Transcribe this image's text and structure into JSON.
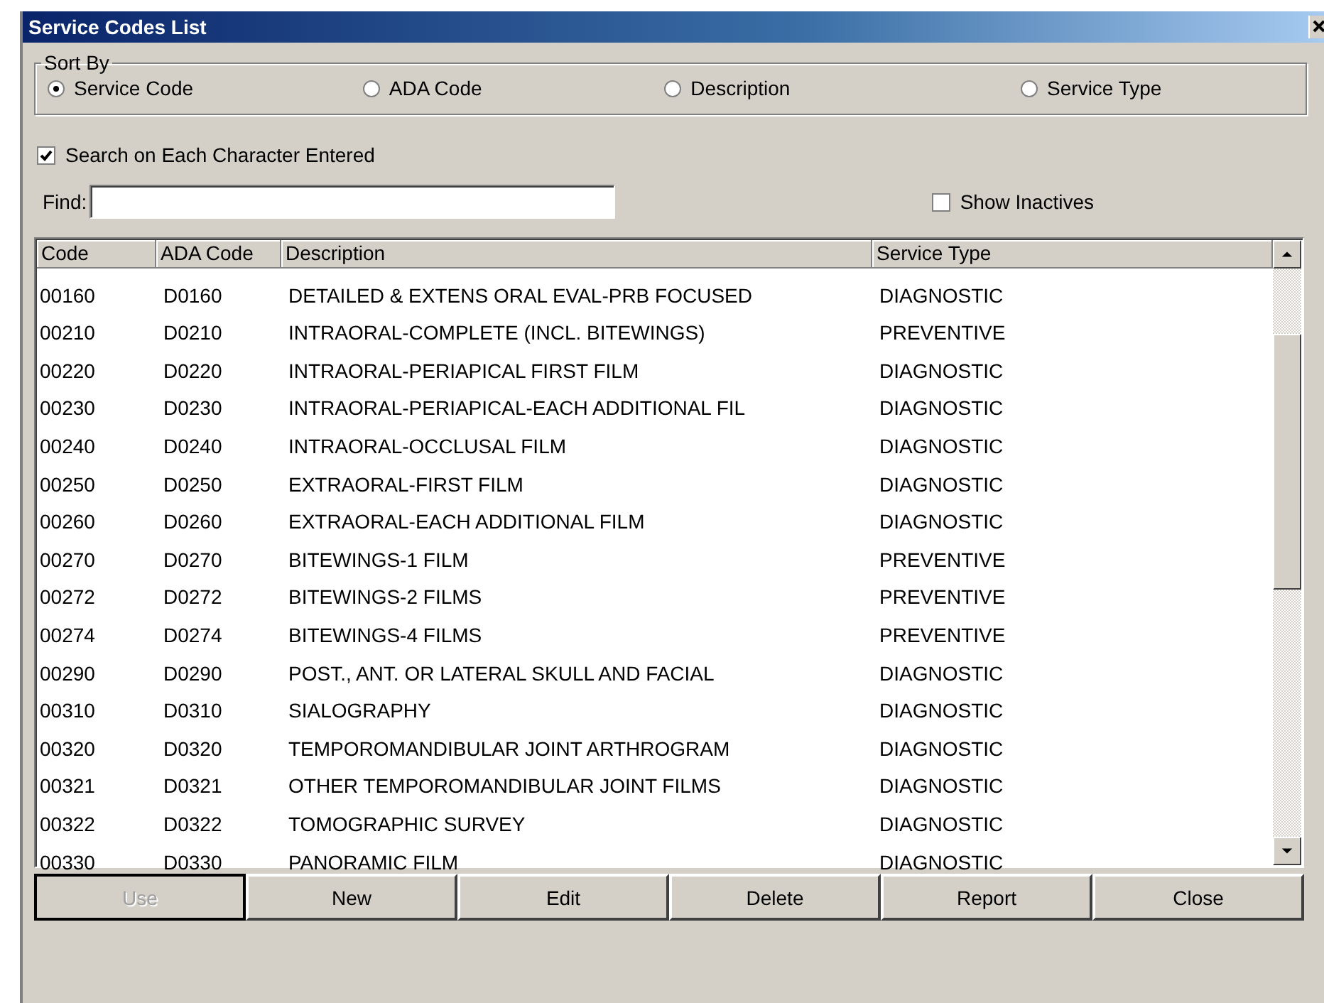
{
  "window": {
    "title": "Service Codes List"
  },
  "sort_by": {
    "label": "Sort By",
    "options": [
      {
        "label": "Service Code",
        "selected": true
      },
      {
        "label": "ADA Code",
        "selected": false
      },
      {
        "label": "Description",
        "selected": false
      },
      {
        "label": "Service Type",
        "selected": false
      }
    ]
  },
  "search_each_char": {
    "label": "Search on Each Character Entered",
    "checked": true
  },
  "find": {
    "label": "Find:"
  },
  "show_inactives": {
    "label": "Show Inactives",
    "checked": false
  },
  "table": {
    "columns": [
      "Code",
      "ADA Code",
      "Description",
      "Service Type"
    ],
    "rows": [
      [
        "00160",
        "D0160",
        "DETAILED & EXTENS ORAL EVAL-PRB FOCUSED",
        "DIAGNOSTIC"
      ],
      [
        "00210",
        "D0210",
        "INTRAORAL-COMPLETE (INCL. BITEWINGS)",
        "PREVENTIVE"
      ],
      [
        "00220",
        "D0220",
        "INTRAORAL-PERIAPICAL FIRST FILM",
        "DIAGNOSTIC"
      ],
      [
        "00230",
        "D0230",
        "INTRAORAL-PERIAPICAL-EACH ADDITIONAL FIL",
        "DIAGNOSTIC"
      ],
      [
        "00240",
        "D0240",
        "INTRAORAL-OCCLUSAL FILM",
        "DIAGNOSTIC"
      ],
      [
        "00250",
        "D0250",
        "EXTRAORAL-FIRST FILM",
        "DIAGNOSTIC"
      ],
      [
        "00260",
        "D0260",
        "EXTRAORAL-EACH ADDITIONAL FILM",
        "DIAGNOSTIC"
      ],
      [
        "00270",
        "D0270",
        "BITEWINGS-1 FILM",
        "PREVENTIVE"
      ],
      [
        "00272",
        "D0272",
        "BITEWINGS-2 FILMS",
        "PREVENTIVE"
      ],
      [
        "00274",
        "D0274",
        "BITEWINGS-4 FILMS",
        "PREVENTIVE"
      ],
      [
        "00290",
        "D0290",
        "POST., ANT. OR LATERAL SKULL AND FACIAL",
        "DIAGNOSTIC"
      ],
      [
        "00310",
        "D0310",
        "SIALOGRAPHY",
        "DIAGNOSTIC"
      ],
      [
        "00320",
        "D0320",
        "TEMPOROMANDIBULAR JOINT ARTHROGRAM",
        "DIAGNOSTIC"
      ],
      [
        "00321",
        "D0321",
        "OTHER TEMPOROMANDIBULAR JOINT FILMS",
        "DIAGNOSTIC"
      ],
      [
        "00322",
        "D0322",
        "TOMOGRAPHIC SURVEY",
        "DIAGNOSTIC"
      ],
      [
        "00330",
        "D0330",
        "PANORAMIC FILM",
        "DIAGNOSTIC"
      ]
    ]
  },
  "buttons": [
    {
      "label": "Use",
      "disabled": true
    },
    {
      "label": "New",
      "disabled": false
    },
    {
      "label": "Edit",
      "disabled": false
    },
    {
      "label": "Delete",
      "disabled": false
    },
    {
      "label": "Report",
      "disabled": false
    },
    {
      "label": "Close",
      "disabled": false
    }
  ]
}
